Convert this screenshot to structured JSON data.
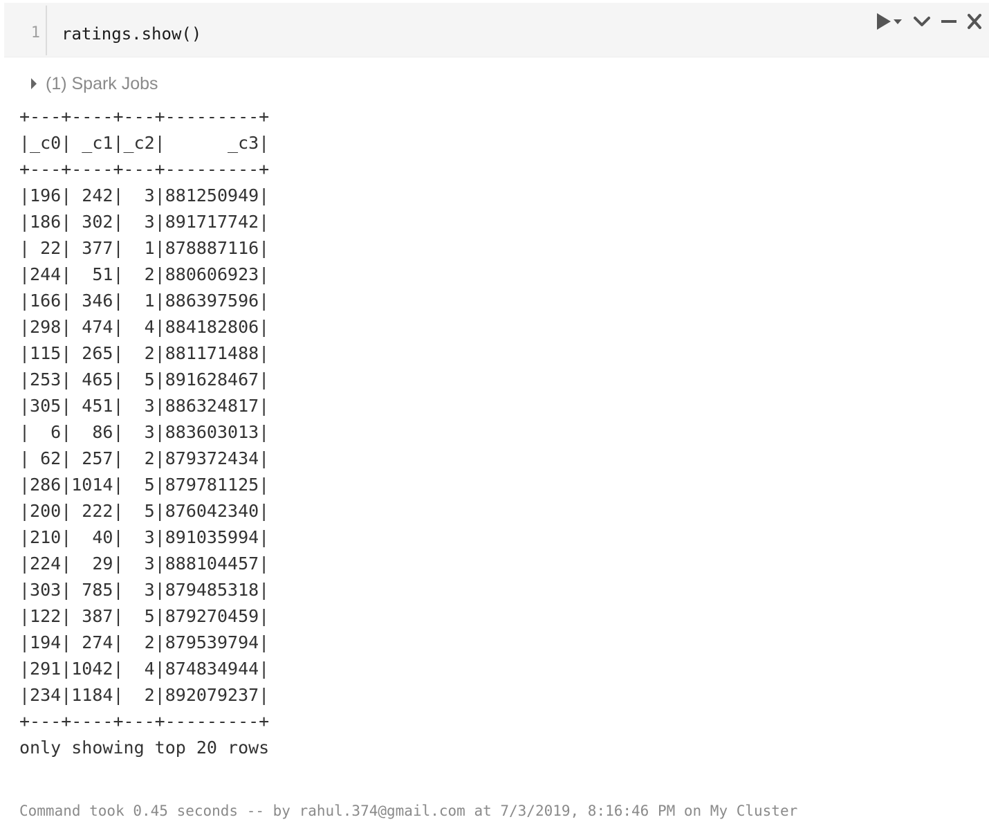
{
  "cell": {
    "line_number": "1",
    "code": "ratings.show()"
  },
  "toolbar": {
    "icons": [
      "run-icon",
      "run-menu-chevron-icon",
      "collapse-chevron-icon",
      "minimize-icon",
      "close-icon"
    ]
  },
  "spark_jobs": {
    "label": "(1) Spark Jobs"
  },
  "output": {
    "lines": [
      "+---+----+---+---------+",
      "|_c0| _c1|_c2|      _c3|",
      "+---+----+---+---------+",
      "|196| 242|  3|881250949|",
      "|186| 302|  3|891717742|",
      "| 22| 377|  1|878887116|",
      "|244|  51|  2|880606923|",
      "|166| 346|  1|886397596|",
      "|298| 474|  4|884182806|",
      "|115| 265|  2|881171488|",
      "|253| 465|  5|891628467|",
      "|305| 451|  3|886324817|",
      "|  6|  86|  3|883603013|",
      "| 62| 257|  2|879372434|",
      "|286|1014|  5|879781125|",
      "|200| 222|  5|876042340|",
      "|210|  40|  3|891035994|",
      "|224|  29|  3|888104457|",
      "|303| 785|  3|879485318|",
      "|122| 387|  5|879270459|",
      "|194| 274|  2|879539794|",
      "|291|1042|  4|874834944|",
      "|234|1184|  2|892079237|",
      "+---+----+---+---------+",
      "only showing top 20 rows"
    ]
  },
  "footer": {
    "text": "Command took 0.45 seconds -- by rahul.374@gmail.com at 7/3/2019, 8:16:46 PM on My Cluster"
  }
}
